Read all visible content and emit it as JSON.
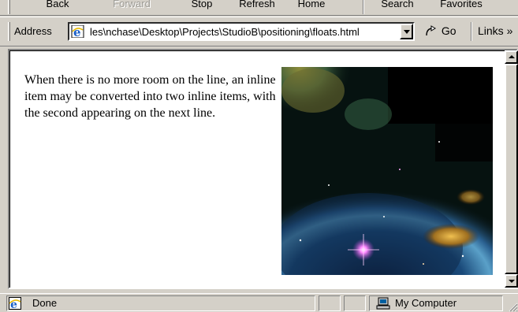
{
  "toolbar": {
    "buttons": [
      {
        "label": "Back",
        "icon": "back-arrow-icon",
        "enabled": true
      },
      {
        "label": "Forward",
        "icon": "forward-arrow-icon",
        "enabled": false
      },
      {
        "label": "Stop",
        "icon": "stop-icon",
        "enabled": true
      },
      {
        "label": "Refresh",
        "icon": "refresh-icon",
        "enabled": true
      },
      {
        "label": "Home",
        "icon": "home-icon",
        "enabled": true
      },
      {
        "label": "Search",
        "icon": "search-icon",
        "enabled": true
      },
      {
        "label": "Favorites",
        "icon": "favorites-icon",
        "enabled": true
      }
    ]
  },
  "addressbar": {
    "label": "Address",
    "url": "les\\nchase\\Desktop\\Projects\\StudioB\\positioning\\floats.html",
    "go_label": "Go",
    "links_label": "Links »"
  },
  "page": {
    "paragraph": "When there is no more room on the line, an inline item may be converted into two inline items, with the second appearing on the next line.",
    "image": "nebula-photo"
  },
  "statusbar": {
    "status": "Done",
    "zone": "My Computer"
  },
  "colors": {
    "chrome": "#d4d0c8",
    "content_bg": "#ffffff"
  }
}
